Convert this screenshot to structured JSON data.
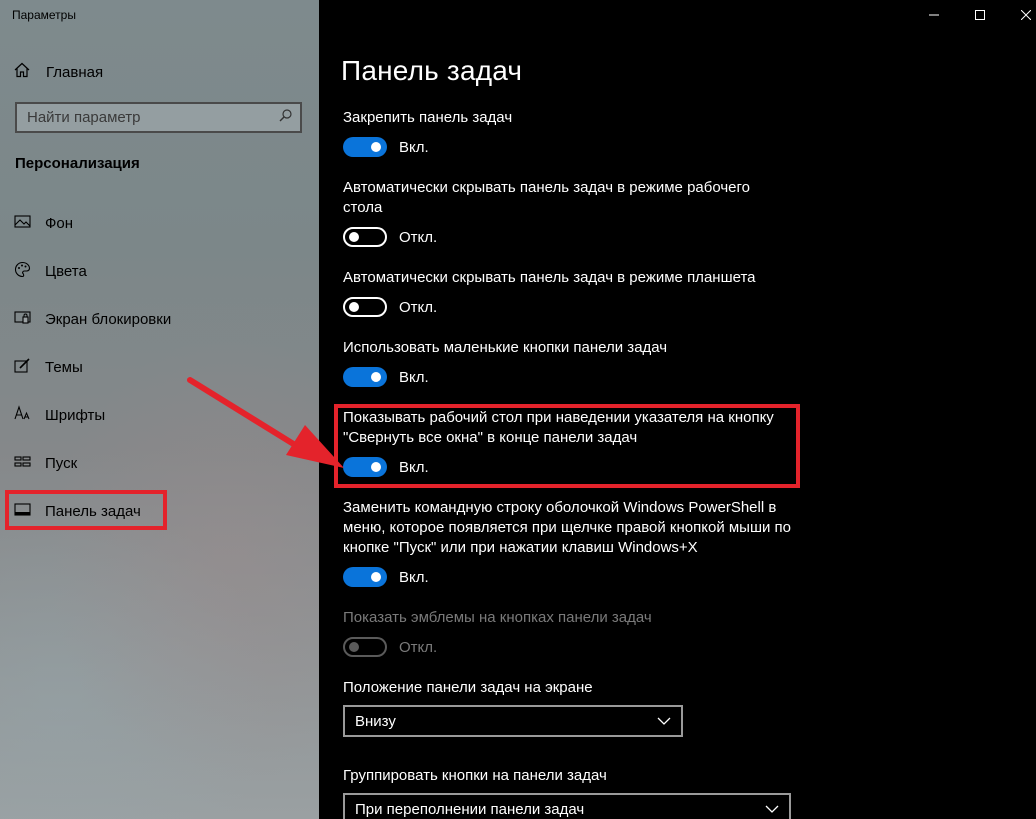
{
  "window": {
    "title": "Параметры"
  },
  "sidebar": {
    "home_label": "Главная",
    "search_placeholder": "Найти параметр",
    "section_title": "Персонализация",
    "items": [
      {
        "label": "Фон",
        "icon": "image-icon"
      },
      {
        "label": "Цвета",
        "icon": "palette-icon"
      },
      {
        "label": "Экран блокировки",
        "icon": "lock-screen-icon"
      },
      {
        "label": "Темы",
        "icon": "brush-icon"
      },
      {
        "label": "Шрифты",
        "icon": "fonts-icon"
      },
      {
        "label": "Пуск",
        "icon": "start-icon"
      },
      {
        "label": "Панель задач",
        "icon": "taskbar-icon",
        "selected": true
      }
    ]
  },
  "main": {
    "title": "Панель задач",
    "settings": [
      {
        "label": "Закрепить панель задач",
        "state": "Вкл."
      },
      {
        "label": "Автоматически скрывать панель задач в режиме рабочего стола",
        "state": "Откл."
      },
      {
        "label": "Автоматически скрывать панель задач в режиме планшета",
        "state": "Откл."
      },
      {
        "label": "Использовать маленькие кнопки панели задач",
        "state": "Вкл."
      },
      {
        "label": "Показывать рабочий стол при наведении указателя на кнопку \"Свернуть все окна\" в конце панели задач",
        "state": "Вкл."
      },
      {
        "label": "Заменить командную строку оболочкой Windows PowerShell в меню, которое появляется при щелчке правой кнопкой мыши по кнопке \"Пуск\" или при нажатии клавиш Windows+X",
        "state": "Вкл."
      },
      {
        "label": "Показать эмблемы на кнопках панели задач",
        "state": "Откл.",
        "disabled": true
      }
    ],
    "position": {
      "label": "Положение панели задач на экране",
      "value": "Внизу"
    },
    "grouping": {
      "label": "Группировать кнопки на панели задач",
      "value": "При переполнении панели задач"
    }
  },
  "colors": {
    "accent": "#0a74da",
    "highlight": "#e4232b"
  }
}
